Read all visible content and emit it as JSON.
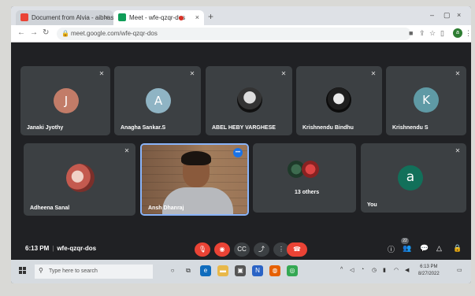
{
  "browser": {
    "tabs": [
      {
        "title": "Document from Alvia - aibhasa...",
        "close": "×",
        "color": "#ea4335"
      },
      {
        "title": "Meet - wfe-qzqr-dos",
        "close": "×",
        "color": "#0f9d58"
      }
    ],
    "new_tab": "+",
    "window_controls": [
      "–",
      "▢",
      "×"
    ],
    "url": "meet.google.com/wfe-qzqr-dos",
    "profile_initial": "a"
  },
  "participants": [
    {
      "name": "Janaki Jyothy",
      "initial": "J",
      "avatar_color": "#c27c68",
      "type": "initial"
    },
    {
      "name": "Anagha Sankar.S",
      "initial": "A",
      "avatar_color": "#8fb4c4",
      "type": "initial"
    },
    {
      "name": "ABEL HEBY VARGHESE",
      "type": "photo"
    },
    {
      "name": "Krishnendu Bindhu",
      "type": "photo"
    },
    {
      "name": "Krishnendu S",
      "initial": "K",
      "avatar_color": "#5f9aa5",
      "type": "initial"
    },
    {
      "name": "Adheena Sanal",
      "type": "photo"
    },
    {
      "name": "Ansh Dhanraj",
      "type": "video"
    },
    {
      "name": "13 others",
      "type": "group"
    },
    {
      "name": "You",
      "initial": "a",
      "avatar_color": "#12705a",
      "type": "initial"
    }
  ],
  "meeting": {
    "time": "6:13 PM",
    "separator": "|",
    "code": "wfe-qzqr-dos",
    "participant_count": "22"
  },
  "controls": {
    "mic": "mic-off",
    "camera": "camera-off",
    "captions": "captions",
    "present": "present",
    "more": "more",
    "hangup": "hang-up"
  },
  "taskbar": {
    "search_placeholder": "Type here to search",
    "clock_time": "6:13 PM",
    "clock_date": "8/27/2022"
  },
  "colors": {
    "danger": "#ea4335",
    "tile_bg": "#3c4043",
    "meet_bg": "#202124",
    "accent": "#1a73e8"
  }
}
